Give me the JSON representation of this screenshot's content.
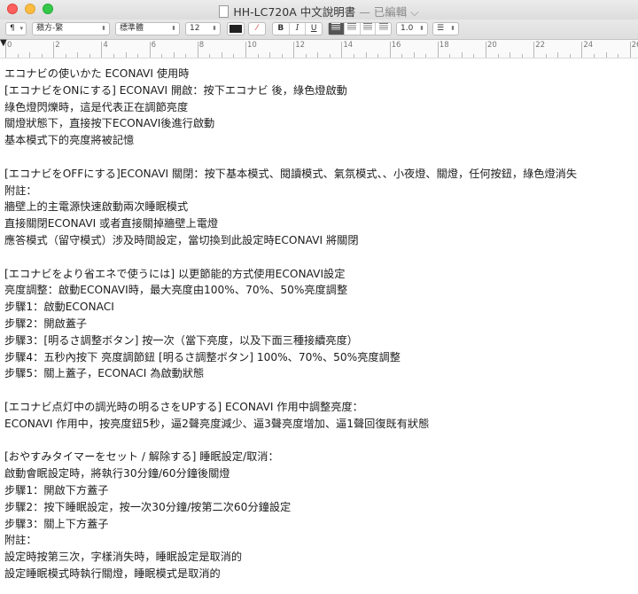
{
  "window": {
    "title": "HH-LC720A 中文說明書",
    "status": "— 已編輯"
  },
  "toolbar": {
    "paragraph_style": "¶",
    "font_family": "蘋方-繁",
    "font_style": "標準體",
    "font_size": "12",
    "bold": "B",
    "italic": "I",
    "underline": "U",
    "line_spacing": "1.0",
    "list_style": "☰"
  },
  "ruler": {
    "labels": [
      "0",
      "2",
      "4",
      "6",
      "8",
      "10",
      "12",
      "14",
      "16",
      "18",
      "20",
      "22",
      "24",
      "26"
    ]
  },
  "document": {
    "lines": [
      "エコナビの使いかた ECONAVI 使用時",
      "[エコナビをONにする] ECONAVI 開啟：按下エコナビ 後，綠色燈啟動",
      "綠色燈閃爍時，這是代表正在調節亮度",
      "關燈狀態下，直接按下ECONAVI後進行啟動",
      "基本模式下的亮度將被記憶",
      "",
      "[エコナビをOFFにする]ECONAVI 關閉：按下基本模式、閱讀模式、氣氛模式、、小夜燈、關燈，任何按鈕，綠色燈消失",
      "附註：",
      "牆壁上的主電源快速啟動兩次睡眠模式",
      "直接關閉ECONAVI 或者直接關掉牆壁上電燈",
      "應答模式（留守模式）涉及時間設定，當切換到此設定時ECONAVI 將關閉",
      "",
      "[エコナビをより省エネで使うには] 以更節能的方式使用ECONAVI設定",
      "亮度調整：啟動ECONAVI時，最大亮度由100%、70%、50%亮度調整",
      "步驟1：啟動ECONACI",
      "步驟2：開啟蓋子",
      "步驟3：[明るさ調整ボタン] 按一次（當下亮度，以及下面三種接續亮度）",
      "步驟4：五秒內按下 亮度調節鈕 [明るさ調整ボタン] 100%、70%、50%亮度調整",
      "步驟5：關上蓋子，ECONACI 為啟動狀態",
      "",
      "[エコナビ点灯中の調光時の明るさをUPする] ECONAVI 作用中調整亮度：",
      "ECONAVI 作用中，按亮度鈕5秒，逼2聲亮度減少、逼3聲亮度增加、逼1聲回復既有狀態",
      "",
      "[おやすみタイマーをセット / 解除する] 睡眠設定/取消：",
      "啟動會眠設定時，將執行30分鐘/60分鐘後關燈",
      "步驟1：開啟下方蓋子",
      "步驟2：按下睡眠設定，按一次30分鐘/按第二次60分鐘設定",
      "步驟3：關上下方蓋子",
      "附註：",
      "設定時按第三次，字樣消失時，睡眠設定是取消的",
      "設定睡眠模式時執行關燈，睡眠模式是取消的"
    ]
  }
}
